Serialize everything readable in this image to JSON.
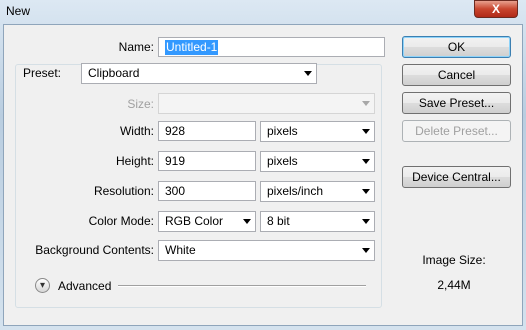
{
  "window": {
    "title": "New",
    "close_glyph": "X"
  },
  "name": {
    "label": "Name:",
    "value": "Untitled-1"
  },
  "preset": {
    "label": "Preset:",
    "value": "Clipboard"
  },
  "size": {
    "label": "Size:",
    "value": ""
  },
  "width": {
    "label": "Width:",
    "value": "928",
    "unit": "pixels"
  },
  "height": {
    "label": "Height:",
    "value": "919",
    "unit": "pixels"
  },
  "resolution": {
    "label": "Resolution:",
    "value": "300",
    "unit": "pixels/inch"
  },
  "color_mode": {
    "label": "Color Mode:",
    "mode": "RGB Color",
    "depth": "8 bit"
  },
  "background": {
    "label": "Background Contents:",
    "value": "White"
  },
  "advanced": {
    "label": "Advanced",
    "icon": "chevron-double-down-icon"
  },
  "buttons": {
    "ok": "OK",
    "cancel": "Cancel",
    "save_preset": "Save Preset...",
    "delete_preset": "Delete Preset...",
    "device_central": "Device Central..."
  },
  "image_size": {
    "label": "Image Size:",
    "value": "2,44M"
  },
  "colors": {
    "selection": "#3399ff",
    "dialog_bg": "#f0f0f0",
    "close_red": "#c8452e"
  }
}
